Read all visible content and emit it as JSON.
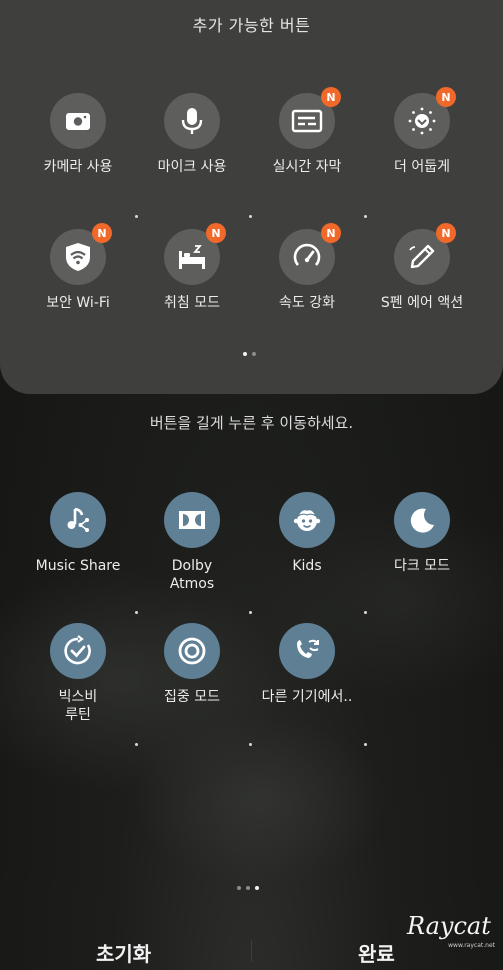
{
  "top_panel": {
    "title": "추가 가능한 버튼",
    "tiles": [
      {
        "label": "카메라 사용",
        "icon": "camera-icon",
        "badge": ""
      },
      {
        "label": "마이크 사용",
        "icon": "microphone-icon",
        "badge": ""
      },
      {
        "label": "실시간 자막",
        "icon": "live-caption-icon",
        "badge": "N"
      },
      {
        "label": "더 어둡게",
        "icon": "extra-dim-icon",
        "badge": "N"
      },
      {
        "label": "보안 Wi-Fi",
        "icon": "secure-wifi-icon",
        "badge": "N"
      },
      {
        "label": "취침 모드",
        "icon": "bed-icon",
        "badge": "N"
      },
      {
        "label": "속도 강화",
        "icon": "speedometer-icon",
        "badge": "N"
      },
      {
        "label": "S펜 에어 액션",
        "icon": "pen-icon",
        "badge": "N"
      }
    ],
    "pages": 2,
    "active_page": 1
  },
  "hint": "버튼을 길게 누른 후 이동하세요.",
  "active_tiles": {
    "tiles": [
      {
        "label": "Music Share",
        "icon": "music-share-icon"
      },
      {
        "label": "Dolby\nAtmos",
        "icon": "dolby-icon"
      },
      {
        "label": "Kids",
        "icon": "kids-icon"
      },
      {
        "label": "다크 모드",
        "icon": "moon-icon"
      },
      {
        "label": "빅스비\n루틴",
        "icon": "bixby-routine-icon"
      },
      {
        "label": "집중 모드",
        "icon": "focus-icon"
      },
      {
        "label": "다른 기기에서..",
        "icon": "call-transfer-icon"
      }
    ],
    "pages": 3,
    "active_page": 3
  },
  "bottom_bar": {
    "reset_label": "초기화",
    "done_label": "완료"
  },
  "watermark": {
    "signature": "Raycat",
    "url": "www.raycat.net"
  },
  "colors": {
    "panel_bg": "#3f3f3d",
    "top_icon_bg": "#5e5e5c",
    "active_icon_bg": "#5f7f95",
    "badge": "#f0692a"
  }
}
